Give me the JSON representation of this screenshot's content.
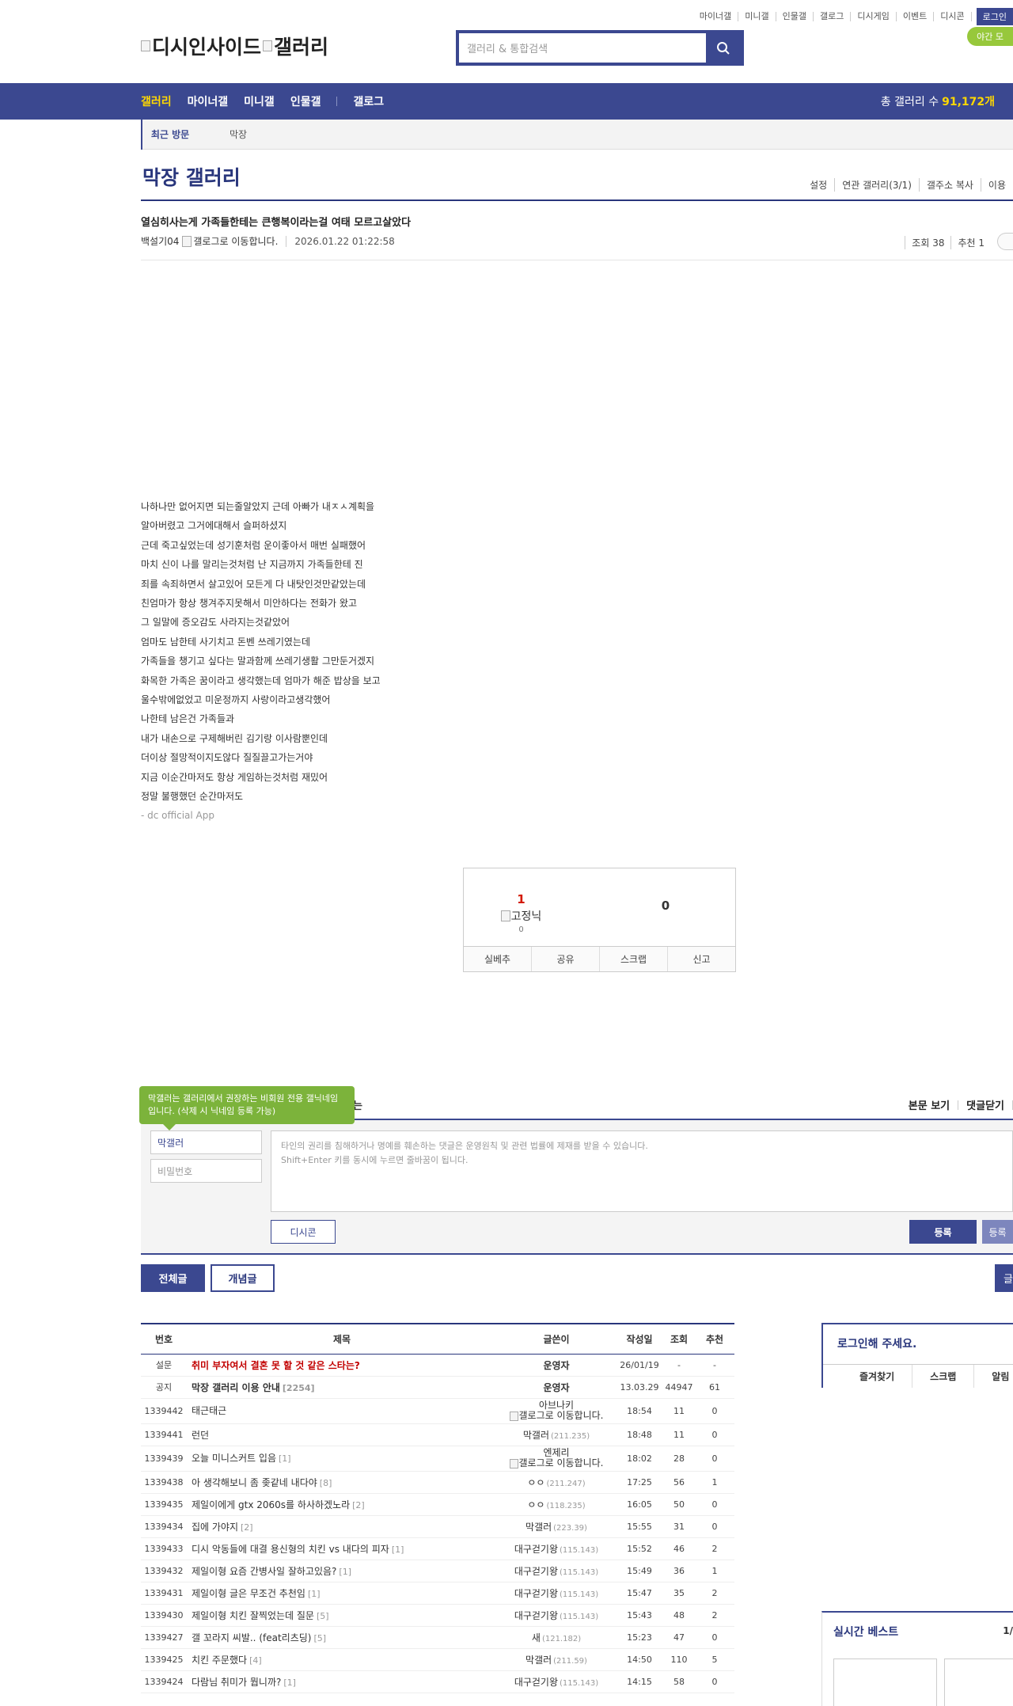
{
  "util_links": [
    "마이너갤",
    "미니갤",
    "인물갤",
    "갤로그",
    "디시게임",
    "이벤트",
    "디시콘"
  ],
  "login_label": "로그인",
  "night_mode": "야간 모",
  "logo": {
    "part1": "디시인사이드",
    "part2": "갤러리"
  },
  "search": {
    "placeholder": "갤러리 & 통합검색",
    "icon": "search-icon"
  },
  "gnb": {
    "items": [
      "갤러리",
      "마이너갤",
      "미니갤",
      "인물갤",
      "갤로그"
    ],
    "total_label": "총 갤러리 수",
    "total_value": "91,172개"
  },
  "recent": {
    "label": "최근 방문",
    "items": [
      "막장"
    ]
  },
  "gallery": {
    "title": "막장 갤러리",
    "tools": [
      "설정",
      "연관 갤러리(3/1)",
      "갤주소 복사",
      "이용"
    ]
  },
  "post": {
    "title": "열심히사는게 가족들한테는 큰행복이라는걸 여태 모르고살았다",
    "author": "백설기04",
    "author_badge": "갤로그로 이동합니다.",
    "date": "2026.01.22 01:22:58",
    "views": "조회 38",
    "recommends": "추천 1",
    "body": [
      "나하나만 없어지면 되는줄알았지 근데 아빠가 내ㅈㅅ계획을",
      "알아버렸고 그거에대해서 슬퍼하셨지",
      "근데 죽고싶었는데 성기훈처럼 운이좋아서 매번 실패했어",
      "마치 신이 나를 말리는것처럼 난 지금까지 가족들한테 진",
      "죄를 속죄하면서 살고있어 모든게 다 내탓인것만같았는데",
      "친엄마가 항상 챙겨주지못해서 미안하다는 전화가 왔고",
      "그 일말에 증오감도 사라지는것같았어",
      "엄마도 남한테 사기치고 돈벤 쓰레기였는데",
      "가족들을 챙기고 싶다는 말과함께 쓰레기생활 그만둔거겠지",
      "화목한 가족은 꿈이라고 생각했는데 엄마가 해준 밥상을 보고",
      "울수밖에없었고 미운정까지 사랑이라고생각했어",
      "나한테 남은건 가족들과",
      "내가 내손으로 구제해버린 김기랑 이사람뿐인데",
      "더이상 절망적이지도않다 질질끌고가는거야",
      "지금 이순간마저도 항상 게임하는것처럼 재밌어",
      "정말 불행했던 순간마저도"
    ],
    "app_sign": "- dc official App"
  },
  "vote": {
    "up_count": "1",
    "fixed_label": "고정닉",
    "fixed_count": "0",
    "down_count": "0",
    "actions": [
      "실베추",
      "공유",
      "스크랩",
      "신고"
    ]
  },
  "comment": {
    "tooltip": "막갤러는 갤러리에서 권장하는 비회원 전용 갤닉네임입니다. (삭제 시 닉네임 등록 가능)",
    "header_tail": "는",
    "view_post": "본문 보기",
    "close_comments": "댓글닫기",
    "nickname": "막갤러",
    "password_placeholder": "비밀번호",
    "textarea_line1": "타인의 권리를 침해하거나 명예를 훼손하는 댓글은 운영원칙 및 관련 법률에 제재를 받을 수 있습니다.",
    "textarea_line2": "Shift+Enter 키를 동시에 누르면 줄바꿈이 됩니다.",
    "dccon": "디시콘",
    "submit": "등록",
    "submit2": "등록"
  },
  "list_tabs": {
    "all": "전체글",
    "recommended": "개념글",
    "right": "글"
  },
  "list": {
    "headers": [
      "번호",
      "제목",
      "글쓴이",
      "작성일",
      "조회",
      "추천"
    ],
    "rows": [
      {
        "num": "설문",
        "title": "취미 부자여서 결혼 못 할 것 같은 스타는?",
        "replies": "",
        "writer": "운영자",
        "ip": "",
        "date": "26/01/19",
        "views": "-",
        "rec": "-",
        "style": "red",
        "wbold": true
      },
      {
        "num": "공지",
        "title": "막장 갤러리 이용 안내",
        "replies": "[2254]",
        "writer": "운영자",
        "ip": "",
        "date": "13.03.29",
        "views": "44947",
        "rec": "61",
        "style": "bold",
        "wbold": true
      },
      {
        "num": "1339442",
        "title": "태근태근",
        "replies": "",
        "writer": "아브나키",
        "ip": "",
        "date": "18:54",
        "views": "11",
        "rec": "0",
        "style": "",
        "badge": "갤로그로 이동합니다."
      },
      {
        "num": "1339441",
        "title": "런던",
        "replies": "",
        "writer": "막갤러",
        "ip": "(211.235)",
        "date": "18:48",
        "views": "11",
        "rec": "0",
        "style": ""
      },
      {
        "num": "1339439",
        "title": "오늘 미니스커트 입음",
        "replies": "[1]",
        "writer": "엔제리",
        "ip": "",
        "date": "18:02",
        "views": "28",
        "rec": "0",
        "style": "",
        "badge": "갤로그로 이동합니다."
      },
      {
        "num": "1339438",
        "title": "아 생각해보니 좀 좆같네 내다야",
        "replies": "[8]",
        "writer": "ㅇㅇ",
        "ip": "(211.247)",
        "date": "17:25",
        "views": "56",
        "rec": "1",
        "style": ""
      },
      {
        "num": "1339435",
        "title": "제일이에게 gtx 2060s를 하사하겠노라",
        "replies": "[2]",
        "writer": "ㅇㅇ",
        "ip": "(118.235)",
        "date": "16:05",
        "views": "50",
        "rec": "0",
        "style": ""
      },
      {
        "num": "1339434",
        "title": "집에 가야지",
        "replies": "[2]",
        "writer": "막갤러",
        "ip": "(223.39)",
        "date": "15:55",
        "views": "31",
        "rec": "0",
        "style": ""
      },
      {
        "num": "1339433",
        "title": "디시 악동들에 대결 용신형의 치킨 vs 내다의 피자",
        "replies": "[1]",
        "writer": "대구걷기왕",
        "ip": "(115.143)",
        "date": "15:52",
        "views": "46",
        "rec": "2",
        "style": ""
      },
      {
        "num": "1339432",
        "title": "제일이형 요즘 간병사일 잘하고있음?",
        "replies": "[1]",
        "writer": "대구걷기왕",
        "ip": "(115.143)",
        "date": "15:49",
        "views": "36",
        "rec": "1",
        "style": ""
      },
      {
        "num": "1339431",
        "title": "제일이형 글은 무조건 추천임",
        "replies": "[1]",
        "writer": "대구걷기왕",
        "ip": "(115.143)",
        "date": "15:47",
        "views": "35",
        "rec": "2",
        "style": ""
      },
      {
        "num": "1339430",
        "title": "제일이형 치킨 잘찍었는데 질문",
        "replies": "[5]",
        "writer": "대구걷기왕",
        "ip": "(115.143)",
        "date": "15:43",
        "views": "48",
        "rec": "2",
        "style": ""
      },
      {
        "num": "1339427",
        "title": "갤 꼬라지 씨발.. (feat리츠딩)",
        "replies": "[5]",
        "writer": "새",
        "ip": "(121.182)",
        "date": "15:23",
        "views": "47",
        "rec": "0",
        "style": ""
      },
      {
        "num": "1339425",
        "title": "치킨 주문했다",
        "replies": "[4]",
        "writer": "막갤러",
        "ip": "(211.59)",
        "date": "14:50",
        "views": "110",
        "rec": "5",
        "style": ""
      },
      {
        "num": "1339424",
        "title": "다람님 취미가 뭡니까?",
        "replies": "[1]",
        "writer": "대구걷기왕",
        "ip": "(115.143)",
        "date": "14:15",
        "views": "58",
        "rec": "0",
        "style": ""
      }
    ]
  },
  "login_panel": {
    "title": "로그인해 주세요.",
    "items": [
      "즐겨찾기",
      "스크랩",
      "알림"
    ]
  },
  "best_panel": {
    "title": "실시간 베스트",
    "page": "1/"
  }
}
